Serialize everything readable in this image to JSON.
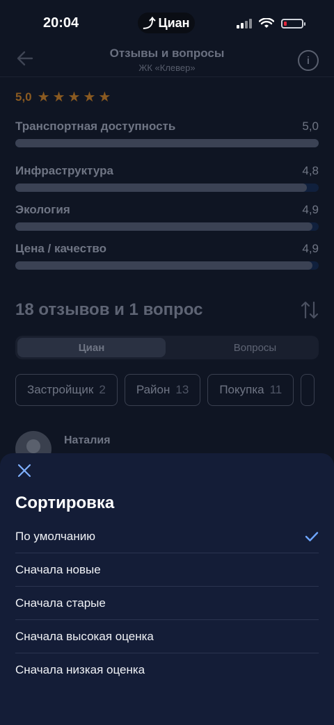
{
  "status_bar": {
    "time": "20:04",
    "app_pill": "Циан"
  },
  "header": {
    "title": "Отзывы и вопросы",
    "subtitle": "ЖК «Клевер»"
  },
  "rating": {
    "value": "5,0",
    "stars": 5
  },
  "criteria": [
    {
      "label": "Транспортная доступность",
      "value": "5,0",
      "fraction": 1.0
    },
    {
      "label": "Инфраструктура",
      "value": "4,8",
      "fraction": 0.96
    },
    {
      "label": "Экология",
      "value": "4,9",
      "fraction": 0.98
    },
    {
      "label": "Цена / качество",
      "value": "4,9",
      "fraction": 0.98
    }
  ],
  "reviews_title": "18 отзывов и 1 вопрос",
  "segments": {
    "active": "Циан",
    "other": "Вопросы"
  },
  "chips": [
    {
      "label": "Застройщик",
      "count": "2"
    },
    {
      "label": "Район",
      "count": "13"
    },
    {
      "label": "Покупка",
      "count": "11"
    }
  ],
  "reviewer": {
    "name": "Наталия"
  },
  "sort_sheet": {
    "title": "Сортировка",
    "options": [
      {
        "label": "По умолчанию",
        "selected": true
      },
      {
        "label": "Сначала новые",
        "selected": false
      },
      {
        "label": "Сначала старые",
        "selected": false
      },
      {
        "label": "Сначала высокая оценка",
        "selected": false
      },
      {
        "label": "Сначала низкая оценка",
        "selected": false
      }
    ]
  },
  "colors": {
    "accent": "#6ea6ff",
    "star": "#8a5a21",
    "sheet_bg": "#141d37",
    "page_bg": "#0f1523"
  }
}
